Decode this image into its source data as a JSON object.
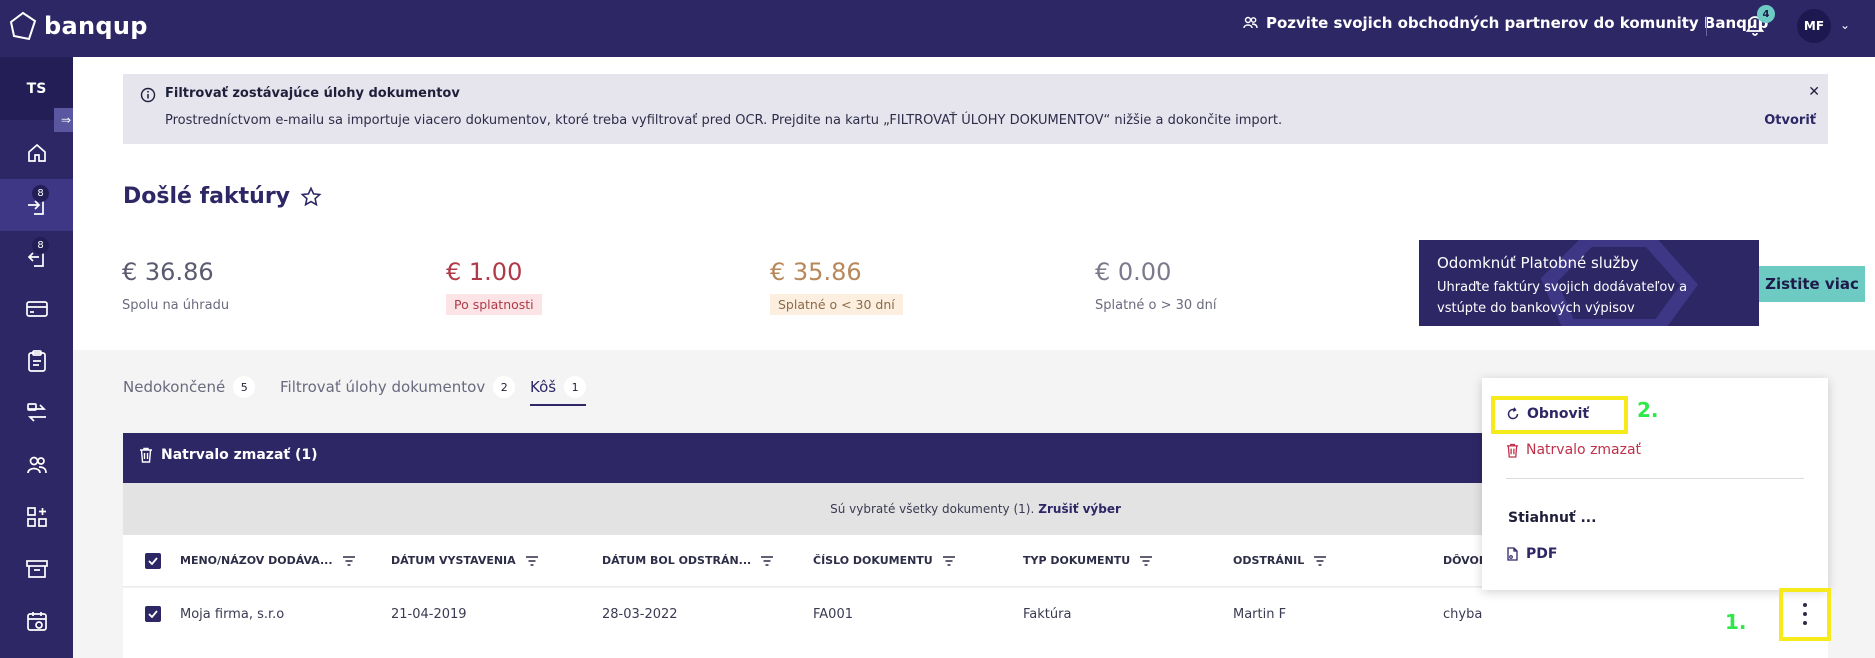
{
  "app": {
    "logo_text": "banqup"
  },
  "topbar": {
    "invite_text": "Pozvite svojich obchodných partnerov do komunity Banqup",
    "notifications_count": "4",
    "user_initials": "MF"
  },
  "sidebar": {
    "workspace_initials": "TS",
    "items": [
      {
        "name": "home",
        "badge": ""
      },
      {
        "name": "incoming-invoices",
        "badge": "8"
      },
      {
        "name": "outgoing-invoices",
        "badge": "8"
      },
      {
        "name": "payments",
        "badge": ""
      },
      {
        "name": "tasks",
        "badge": ""
      },
      {
        "name": "transfers",
        "badge": ""
      },
      {
        "name": "contacts",
        "badge": ""
      },
      {
        "name": "apps",
        "badge": ""
      },
      {
        "name": "archive",
        "badge": ""
      },
      {
        "name": "schedule",
        "badge": ""
      }
    ]
  },
  "banner": {
    "title": "Filtrovať zostávajúce úlohy dokumentov",
    "text": "Prostredníctvom e-mailu sa importuje viacero dokumentov, ktoré treba vyfiltrovať pred OCR. Prejdite na kartu „FILTROVAŤ ÚLOHY DOKUMENTOV“ nižšie a dokončite import.",
    "close": "✕",
    "link": "Otvoriť"
  },
  "page": {
    "title": "Došlé faktúry"
  },
  "stats": [
    {
      "value": "€ 36.86",
      "label": "Spolu na úhradu",
      "color": "#5a5a70"
    },
    {
      "value": "€ 1.00",
      "label": "Po splatnosti",
      "color": "#b03a48",
      "chip_bg": "#fbe3e6"
    },
    {
      "value": "€ 35.86",
      "label": "Splatné o < 30 dní",
      "color": "#b8875a",
      "chip_bg": "#fcefe0"
    },
    {
      "value": "€ 0.00",
      "label": "Splatné o > 30 dní",
      "color": "#7a7a8c"
    }
  ],
  "promo": {
    "title": "Odomknúť Platobné služby",
    "text": "Uhraďte faktúry svojich dodávateľov a vstúpte do bankových výpisov",
    "button": "Zistite viac"
  },
  "tabs": [
    {
      "label": "Nedokončené",
      "count": "5"
    },
    {
      "label": "Filtrovať úlohy dokumentov",
      "count": "2"
    },
    {
      "label": "Kôš",
      "count": "1"
    }
  ],
  "table": {
    "header_action": "Natrvalo zmazať (1)",
    "selection_text": "Sú vybraté všetky dokumenty (1).",
    "selection_link": "Zrušiť výber",
    "columns": [
      "MENO/NÁZOV DODÁVA...",
      "DÁTUM VYSTAVENIA",
      "DÁTUM BOL ODSTRÁN...",
      "ČÍSLO DOKUMENTU",
      "TYP DOKUMENTU",
      "ODSTRÁNIL",
      "DÔVOD"
    ],
    "rows": [
      [
        "Moja firma, s.r.o",
        "21-04-2019",
        "28-03-2022",
        "FA001",
        "Faktúra",
        "Martin F",
        "chyba"
      ]
    ]
  },
  "menu": {
    "restore": "Obnoviť",
    "delete": "Natrvalo zmazať",
    "download_heading": "Stiahnuť ...",
    "pdf": "PDF"
  },
  "annotations": {
    "step1": "1.",
    "step2": "2."
  },
  "colors": {
    "primary": "#2e2766",
    "accent": "#6ecbc3",
    "danger": "#c0304a",
    "highlight": "#f7ea1a",
    "step_label": "#2ee84a"
  }
}
